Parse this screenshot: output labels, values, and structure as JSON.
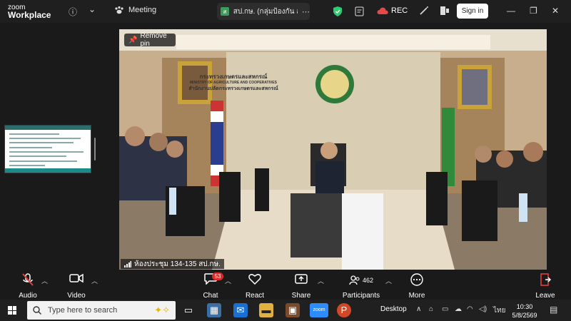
{
  "app": {
    "logo_line1": "zoom",
    "logo_line2": "Workplace"
  },
  "topbar": {
    "info_icon": "ⓘ",
    "chevron_icon": "⌄",
    "meeting_label": "Meeting",
    "tab_title": "สป.กษ. (กลุ่มป้องกัน สผพ.",
    "tab_badge": "ส",
    "rec_label": "REC",
    "signin_label": "Sign in"
  },
  "video": {
    "pin_label": "Remove pin",
    "participant_name": "ห้องประชุม 134-135 สป.กษ.",
    "room_sign_line1": "กระทรวงเกษตรและสหกรณ์",
    "room_sign_line2": "MINISTRY OF AGRICULTURE AND COOPERATIVES",
    "room_sign_line3": "สำนักงานปลัดกระทรวงเกษตรและสหกรณ์"
  },
  "controls": {
    "audio": "Audio",
    "video": "Video",
    "chat": "Chat",
    "chat_badge": "53",
    "react": "React",
    "share": "Share",
    "participants": "Participants",
    "participants_count": "462",
    "more": "More",
    "leave": "Leave"
  },
  "taskbar": {
    "search_placeholder": "Type here to search",
    "desktop_label": "Desktop",
    "lang": "ไทย",
    "time": "10:30",
    "date": "5/8/2569"
  },
  "colors": {
    "topbar_bg": "#1f1f1f",
    "badge_red": "#e02828",
    "shield_green": "#2ecc71",
    "leave_red": "#e04040"
  }
}
